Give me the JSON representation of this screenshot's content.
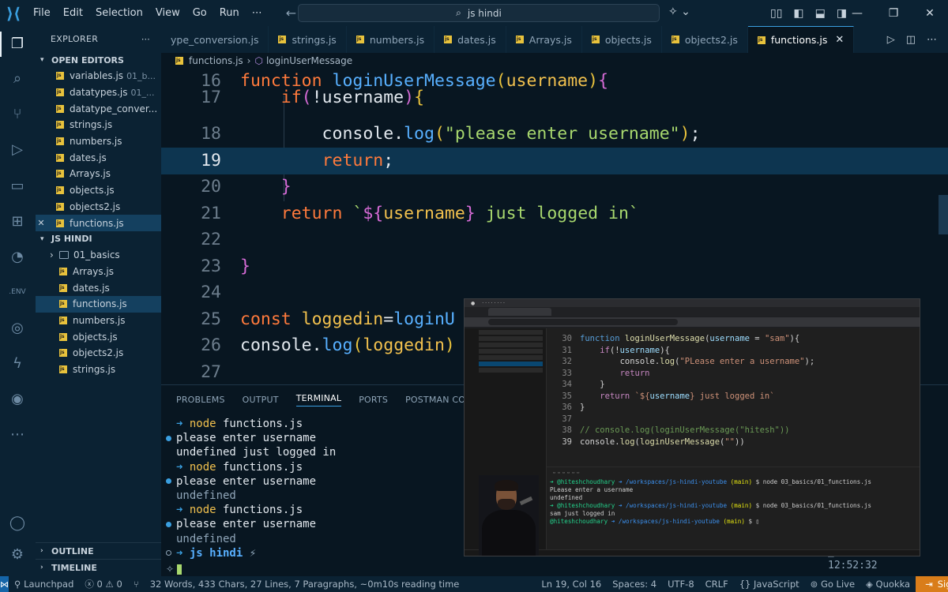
{
  "titlebar": {
    "menu": [
      "File",
      "Edit",
      "Selection",
      "View",
      "Go",
      "Run",
      "⋯"
    ],
    "search": "js hindi"
  },
  "sidebar": {
    "title": "EXPLORER",
    "open_editors_label": "OPEN EDITORS",
    "open_editors": [
      {
        "name": "variables.js",
        "desc": "01_b..."
      },
      {
        "name": "datatypes.js",
        "desc": "01_..."
      },
      {
        "name": "datatype_conver...",
        "desc": ""
      },
      {
        "name": "strings.js",
        "desc": ""
      },
      {
        "name": "numbers.js",
        "desc": ""
      },
      {
        "name": "dates.js",
        "desc": ""
      },
      {
        "name": "Arrays.js",
        "desc": ""
      },
      {
        "name": "objects.js",
        "desc": ""
      },
      {
        "name": "objects2.js",
        "desc": ""
      },
      {
        "name": "functions.js",
        "desc": ""
      }
    ],
    "workspace_label": "JS HINDI",
    "workspace": [
      {
        "name": "01_basics",
        "kind": "folder"
      },
      {
        "name": "Arrays.js",
        "kind": "file"
      },
      {
        "name": "dates.js",
        "kind": "file"
      },
      {
        "name": "functions.js",
        "kind": "file"
      },
      {
        "name": "numbers.js",
        "kind": "file"
      },
      {
        "name": "objects.js",
        "kind": "file"
      },
      {
        "name": "objects2.js",
        "kind": "file"
      },
      {
        "name": "strings.js",
        "kind": "file"
      }
    ],
    "outline_label": "OUTLINE",
    "timeline_label": "TIMELINE"
  },
  "tabs": [
    "ype_conversion.js",
    "strings.js",
    "numbers.js",
    "dates.js",
    "Arrays.js",
    "objects.js",
    "objects2.js",
    "functions.js"
  ],
  "active_tab": "functions.js",
  "breadcrumb": {
    "file": "functions.js",
    "symbol": "loginUserMessage"
  },
  "editor": {
    "current_line": 19,
    "lines": [
      {
        "n": "16",
        "code": [
          [
            "kw",
            "function "
          ],
          [
            "fn",
            "loginUserMessage"
          ],
          [
            "br",
            "("
          ],
          [
            "pm",
            "username"
          ],
          [
            "br",
            ")"
          ],
          [
            "br2",
            "{"
          ]
        ]
      },
      {
        "n": "17",
        "code": [
          [
            "tx",
            "    "
          ],
          [
            "kw",
            "if"
          ],
          [
            "br2",
            "("
          ],
          [
            "tx",
            "!username"
          ],
          [
            "br2",
            ")"
          ],
          [
            "br",
            "{"
          ]
        ]
      },
      {
        "n": "18",
        "code": [
          [
            "tx",
            "        console."
          ],
          [
            "fn",
            "log"
          ],
          [
            "br",
            "("
          ],
          [
            "st",
            "\"please enter username\""
          ],
          [
            "br",
            ")"
          ],
          [
            "tx",
            ";"
          ]
        ]
      },
      {
        "n": "19",
        "code": [
          [
            "tx",
            "        "
          ],
          [
            "kw",
            "return"
          ],
          [
            "tx",
            ";"
          ]
        ]
      },
      {
        "n": "20",
        "code": [
          [
            "tx",
            "    "
          ],
          [
            "br2",
            "}"
          ]
        ]
      },
      {
        "n": "21",
        "code": [
          [
            "tx",
            "    "
          ],
          [
            "kw",
            "return "
          ],
          [
            "st",
            "`"
          ],
          [
            "br2",
            "${"
          ],
          [
            "pm",
            "username"
          ],
          [
            "br2",
            "}"
          ],
          [
            "st",
            " just logged in`"
          ]
        ]
      },
      {
        "n": "22",
        "code": []
      },
      {
        "n": "23",
        "code": [
          [
            "br2",
            "}"
          ]
        ]
      },
      {
        "n": "24",
        "code": []
      },
      {
        "n": "25",
        "code": [
          [
            "kw",
            "const "
          ],
          [
            "iv",
            "loggedin"
          ],
          [
            "tx",
            "="
          ],
          [
            "fn",
            "loginU"
          ]
        ]
      },
      {
        "n": "26",
        "code": [
          [
            "tx",
            "console."
          ],
          [
            "fn",
            "log"
          ],
          [
            "br",
            "("
          ],
          [
            "iv",
            "loggedin"
          ],
          [
            "br",
            ")"
          ]
        ]
      },
      {
        "n": "27",
        "code": []
      }
    ]
  },
  "panel": {
    "tabs": [
      "PROBLEMS",
      "OUTPUT",
      "TERMINAL",
      "PORTS",
      "POSTMAN CONSOLE"
    ],
    "active": "TERMINAL",
    "terminal": [
      {
        "mark": "none",
        "parts": [
          [
            "arrow",
            "➜ "
          ],
          [
            "cmd",
            "node"
          ],
          [
            "txt",
            " functions.js"
          ]
        ]
      },
      {
        "mark": "dot",
        "parts": [
          [
            "txt",
            "please enter username"
          ]
        ]
      },
      {
        "mark": "none",
        "parts": [
          [
            "txt",
            "undefined just logged in"
          ]
        ]
      },
      {
        "mark": "none",
        "parts": [
          [
            "arrow",
            "➜ "
          ],
          [
            "cmd",
            "node"
          ],
          [
            "txt",
            " functions.js"
          ]
        ]
      },
      {
        "mark": "dot",
        "parts": [
          [
            "txt",
            "please enter username"
          ]
        ]
      },
      {
        "mark": "none",
        "parts": [
          [
            "dim",
            "undefined"
          ]
        ]
      },
      {
        "mark": "none",
        "parts": [
          [
            "arrow",
            "➜ "
          ],
          [
            "cmd",
            "node"
          ],
          [
            "txt",
            " functions.js"
          ]
        ]
      },
      {
        "mark": "dot",
        "parts": [
          [
            "txt",
            "please enter username"
          ]
        ]
      },
      {
        "mark": "none",
        "parts": [
          [
            "dim",
            "undefined"
          ]
        ]
      },
      {
        "mark": "ring",
        "parts": [
          [
            "arrow",
            "➜ "
          ],
          [
            "dir",
            "js hindi"
          ],
          [
            "dim",
            " ⚡"
          ]
        ]
      }
    ]
  },
  "pip": {
    "editor_lines": [
      {
        "n": "30",
        "code": [
          [
            "p-kw",
            "function "
          ],
          [
            "p-fn",
            "loginUserMessage"
          ],
          [
            "",
            "("
          ],
          [
            "p-pm",
            "username"
          ],
          [
            "",
            " = "
          ],
          [
            "p-st",
            "\"sam\""
          ],
          [
            "",
            "){"
          ]
        ]
      },
      {
        "n": "31",
        "code": [
          [
            "",
            "    "
          ],
          [
            "p-ctl",
            "if"
          ],
          [
            "",
            "(!"
          ],
          [
            "p-pm",
            "username"
          ],
          [
            "",
            "){"
          ]
        ]
      },
      {
        "n": "32",
        "code": [
          [
            "",
            "        console."
          ],
          [
            "p-fn",
            "log"
          ],
          [
            "",
            "("
          ],
          [
            "p-st",
            "\"PLease enter a username\""
          ],
          [
            "",
            ");"
          ]
        ]
      },
      {
        "n": "33",
        "code": [
          [
            "",
            "        "
          ],
          [
            "p-ctl",
            "return"
          ]
        ]
      },
      {
        "n": "34",
        "code": [
          [
            "",
            "    }"
          ]
        ]
      },
      {
        "n": "35",
        "code": [
          [
            "",
            "    "
          ],
          [
            "p-ctl",
            "return "
          ],
          [
            "p-st",
            "`${"
          ],
          [
            "p-pm",
            "username"
          ],
          [
            "p-st",
            "} just logged in`"
          ]
        ]
      },
      {
        "n": "36",
        "code": [
          [
            "",
            "}"
          ]
        ]
      },
      {
        "n": "37",
        "code": []
      },
      {
        "n": "38",
        "code": [
          [
            "p-cm",
            "// console.log(loginUserMessage(\"hitesh\"))"
          ]
        ]
      },
      {
        "n": "39",
        "code": [
          [
            "",
            "console."
          ],
          [
            "p-fn",
            "log"
          ],
          [
            "",
            "("
          ],
          [
            "p-fn",
            "loginUserMessage"
          ],
          [
            "",
            "("
          ],
          [
            "p-st",
            "\"\""
          ],
          [
            "",
            "))"
          ]
        ]
      }
    ],
    "terminal_lines": [
      {
        "parts": [
          [
            "p-green",
            "➜ @hiteshchoudhary "
          ],
          [
            "p-blue",
            "➜ /workspaces/js-hindi-youtube "
          ],
          [
            "p-yel",
            "(main)"
          ],
          [
            "",
            " $ node 03_basics/01_functions.js"
          ]
        ]
      },
      {
        "parts": [
          [
            "",
            "PLease enter a username"
          ]
        ]
      },
      {
        "parts": [
          [
            "",
            "undefined"
          ]
        ]
      },
      {
        "parts": [
          [
            "p-green",
            "➜ @hiteshchoudhary "
          ],
          [
            "p-blue",
            "➜ /workspaces/js-hindi-youtube "
          ],
          [
            "p-yel",
            "(main)"
          ],
          [
            "",
            " $ node 03_basics/01_functions.js"
          ]
        ]
      },
      {
        "parts": [
          [
            "",
            "sam just logged in"
          ]
        ]
      },
      {
        "parts": [
          [
            "p-green",
            "@hiteshchoudhary "
          ],
          [
            "p-blue",
            "➜ /workspaces/js-hindi-youtube "
          ],
          [
            "p-yel",
            "(main)"
          ],
          [
            "",
            " $ ▯"
          ]
        ]
      }
    ]
  },
  "status": {
    "launchpad": "Launchpad",
    "errors": "0",
    "warnings": "0",
    "stats": "32 Words, 433 Chars, 27 Lines, 7 Paragraphs, ~0m10s reading time",
    "position": "Ln 19, Col 16",
    "spaces": "Spaces: 4",
    "encoding": "UTF-8",
    "eol": "CRLF",
    "language": "JavaScript",
    "golive": "Go Live",
    "quokka": "Quokka",
    "signin": "Sign In"
  },
  "colors": {
    "accent": "#3a9fe0",
    "signin": "#d97d1a",
    "keyword": "#ff7a3c",
    "function": "#58b0ff",
    "string": "#a8d86e"
  }
}
